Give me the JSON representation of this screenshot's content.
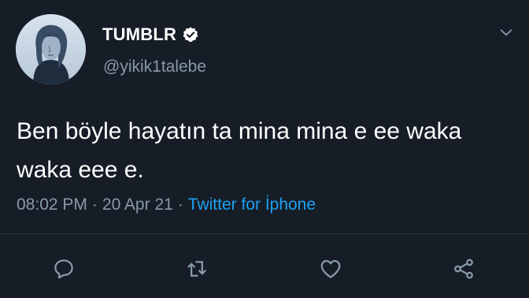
{
  "tweet": {
    "display_name": "TUMBLR",
    "handle": "@yikik1talebe",
    "text": "Ben böyle hayatın ta mina mina e ee waka waka eee e.",
    "time": "08:02 PM",
    "date": "20 Apr 21",
    "separator": "·",
    "source": "Twitter for İphone",
    "verified": true
  },
  "colors": {
    "background": "#161d27",
    "text": "#ffffff",
    "secondary": "#8899a6",
    "link": "#1da1f2"
  },
  "icons": {
    "verified": "verified-badge-icon",
    "caret": "chevron-down-icon",
    "reply": "reply-icon",
    "retweet": "retweet-icon",
    "like": "heart-icon",
    "share": "share-icon"
  }
}
